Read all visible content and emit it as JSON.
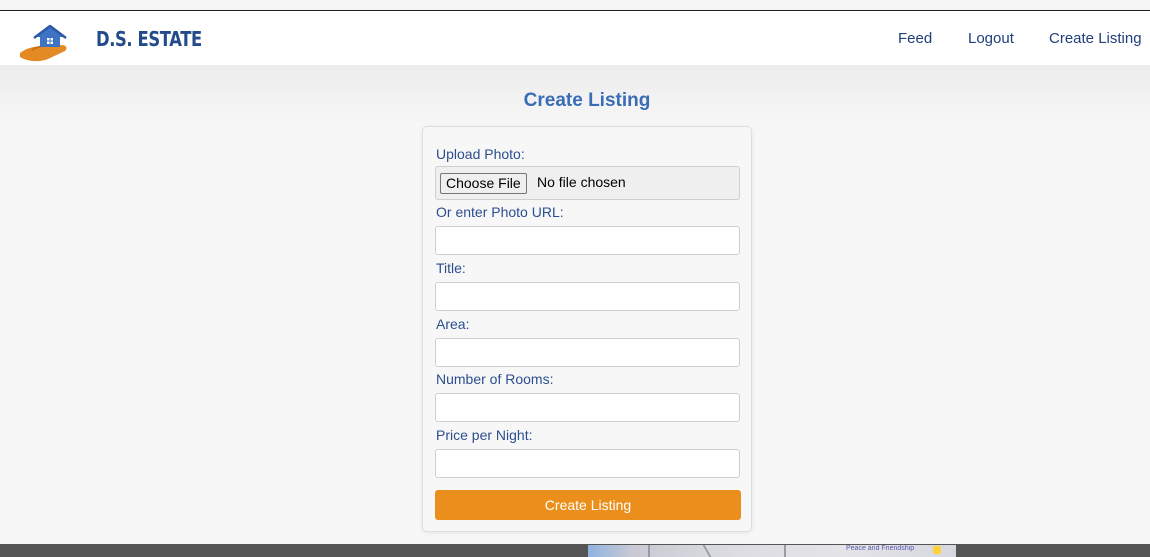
{
  "brand": {
    "name": "D.S. ESTATE",
    "logo_icon": "house-in-hand-icon"
  },
  "nav": {
    "links": [
      {
        "label": "Feed"
      },
      {
        "label": "Logout"
      },
      {
        "label": "Create Listing"
      }
    ]
  },
  "page": {
    "title": "Create Listing"
  },
  "form": {
    "upload_label": "Upload Photo:",
    "file_button_label": "Choose File",
    "file_status": "No file chosen",
    "photo_url_label": "Or enter Photo URL:",
    "photo_url_value": "",
    "title_label": "Title:",
    "title_value": "",
    "area_label": "Area:",
    "area_value": "",
    "rooms_label": "Number of Rooms:",
    "rooms_value": "",
    "price_label": "Price per Night:",
    "price_value": "",
    "submit_label": "Create Listing"
  },
  "footer": {
    "map_label": "Peace and Friendship"
  },
  "colors": {
    "brand_blue": "#234a8a",
    "title_blue": "#3a6db5",
    "accent_orange": "#ea8f1c",
    "footer_gray": "#555555"
  }
}
